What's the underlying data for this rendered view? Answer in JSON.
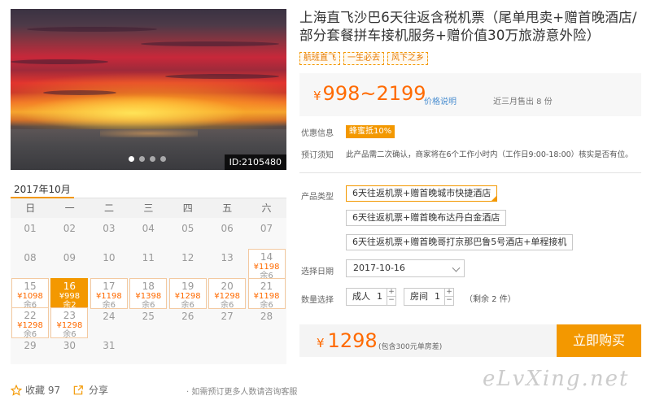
{
  "photo": {
    "id_label": "ID:2105480",
    "slide_count": 4,
    "active_slide": 1
  },
  "calendar": {
    "month_label": "2017年10月",
    "weekdays": [
      "日",
      "一",
      "二",
      "三",
      "四",
      "五",
      "六"
    ],
    "weeks": [
      [
        {
          "day": "01"
        },
        {
          "day": "02"
        },
        {
          "day": "03"
        },
        {
          "day": "04"
        },
        {
          "day": "05"
        },
        {
          "day": "06"
        },
        {
          "day": "07"
        }
      ],
      [
        {
          "day": "08"
        },
        {
          "day": "09"
        },
        {
          "day": "10"
        },
        {
          "day": "11"
        },
        {
          "day": "12"
        },
        {
          "day": "13"
        },
        {
          "day": "14",
          "price": "¥1198",
          "remain": "余6"
        }
      ],
      [
        {
          "day": "15",
          "price": "¥1098",
          "remain": "余6"
        },
        {
          "day": "16",
          "price": "¥998",
          "remain": "余2",
          "selected": true
        },
        {
          "day": "17",
          "price": "¥1198",
          "remain": "余6"
        },
        {
          "day": "18",
          "price": "¥1398",
          "remain": "余6"
        },
        {
          "day": "19",
          "price": "¥1298",
          "remain": "余6"
        },
        {
          "day": "20",
          "price": "¥1298",
          "remain": "余6"
        },
        {
          "day": "21",
          "price": "¥1198",
          "remain": "余6"
        }
      ],
      [
        {
          "day": "22",
          "price": "¥1298",
          "remain": "余6"
        },
        {
          "day": "23",
          "price": "¥1298",
          "remain": "余6"
        },
        {
          "day": "24"
        },
        {
          "day": "25"
        },
        {
          "day": "26"
        },
        {
          "day": "27"
        },
        {
          "day": "28"
        }
      ],
      [
        {
          "day": "29"
        },
        {
          "day": "30"
        },
        {
          "day": "31"
        }
      ]
    ]
  },
  "footer": {
    "favorite_label": "收藏 97",
    "share_label": "分享",
    "consult_text": "· 如需预订更多人数请咨询客服"
  },
  "product": {
    "title": "上海直飞沙巴6天往返含税机票（尾单甩卖+赠首晚酒店/部分套餐拼车接机服务+赠价值30万旅游意外险）",
    "tags": [
      "航班直飞",
      "一生必去",
      "风下之乡"
    ],
    "price_range": "998~2199",
    "currency": "¥",
    "price_link": "价格说明",
    "sold_text": "近三月售出 8 份",
    "discount_label": "优惠信息",
    "discount_badge": "蜂蜜抵10%",
    "notice_label": "预订须知",
    "notice_text": "此产品需二次确认，商家将在6个工作小时内（工作日9:00-18:00）核实是否有位。",
    "type_label": "产品类型",
    "options": [
      "6天往返机票+赠首晚城市快捷酒店",
      "6天往返机票+赠首晚布达丹白金酒店",
      "6天往返机票+赠首晚哥打京那巴鲁5号酒店+单程接机"
    ],
    "selected_option": 0,
    "date_label": "选择日期",
    "date_value": "2017-10-16",
    "qty_label": "数量选择",
    "adult_label": "成人",
    "adult_value": "1",
    "room_label": "房间",
    "room_value": "1",
    "remain_text": "（剩余 2 件）",
    "total_price": "1298",
    "total_note": "(包含300元单房差)",
    "buy_label": "立即购买"
  },
  "watermark": "eLvXing.net",
  "colors": {
    "accent": "#f39800",
    "price": "#ff6a00",
    "link": "#4a8ed0"
  }
}
